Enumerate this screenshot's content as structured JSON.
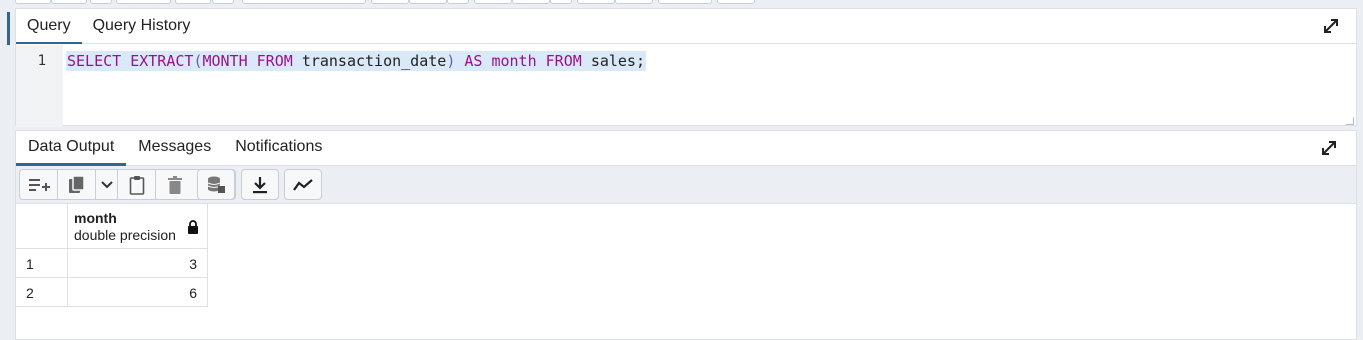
{
  "query_panel": {
    "tabs": [
      {
        "label": "Query",
        "active": true
      },
      {
        "label": "Query History",
        "active": false
      }
    ],
    "editor": {
      "line_number": "1",
      "tokens": {
        "t1": "SELECT",
        "t2": "EXTRACT",
        "t3": "(",
        "t4": "MONTH",
        "t5": "FROM",
        "t6": "transaction_date",
        "t7": ")",
        "t8": "AS",
        "t9": "month",
        "t10": "FROM",
        "t11": "sales;"
      }
    },
    "expand_icon": "expand-icon"
  },
  "output_panel": {
    "tabs": [
      {
        "label": "Data Output",
        "active": true
      },
      {
        "label": "Messages",
        "active": false
      },
      {
        "label": "Notifications",
        "active": false
      }
    ],
    "toolbar_icons": [
      "add-row-icon",
      "copy-icon",
      "chevron-down-icon",
      "paste-icon",
      "delete-icon",
      "save-data-icon",
      "download-icon",
      "graph-icon"
    ],
    "grid": {
      "columns": [
        {
          "name": "month",
          "type": "double precision",
          "locked": true
        }
      ],
      "rows": [
        {
          "row_no": "1",
          "values": [
            "3"
          ]
        },
        {
          "row_no": "2",
          "values": [
            "6"
          ]
        }
      ]
    }
  },
  "colors": {
    "accent": "#326690",
    "keyword": "#9b0f93",
    "selection": "#d9e9f7"
  }
}
